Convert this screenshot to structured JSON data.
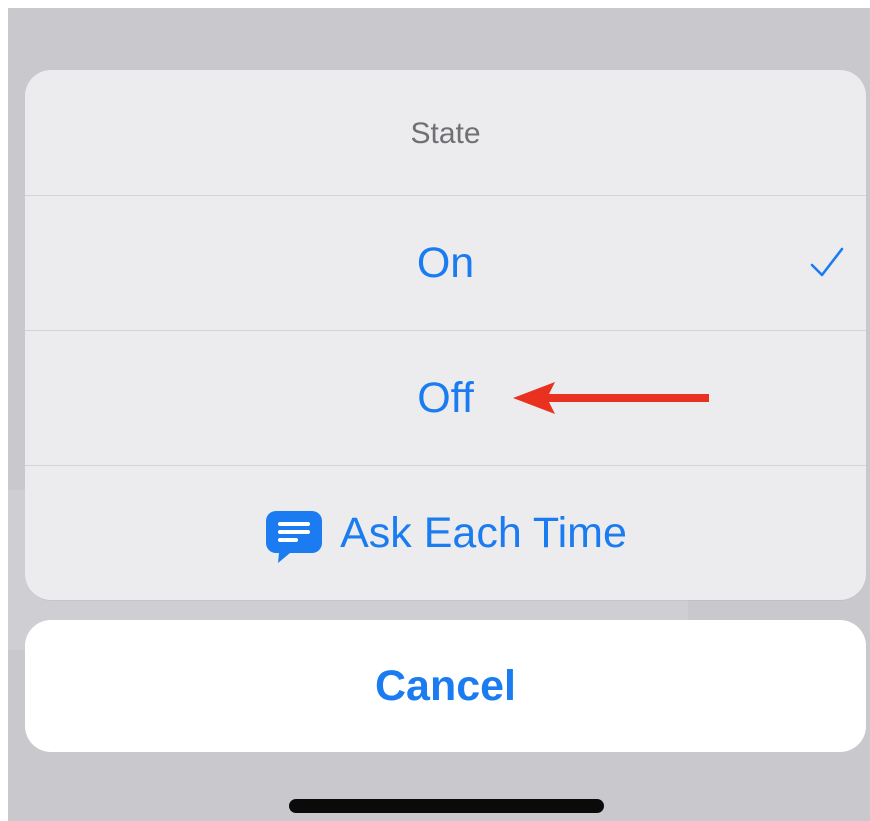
{
  "action_sheet": {
    "title": "State",
    "options": [
      {
        "label": "On",
        "selected": true,
        "icon": "checkmark-icon"
      },
      {
        "label": "Off",
        "selected": false,
        "annotation": "red-arrow-icon"
      },
      {
        "label": "Ask Each Time",
        "selected": false,
        "icon": "speech-bubble-icon"
      }
    ],
    "cancel_label": "Cancel"
  },
  "colors": {
    "accent": "#1a7cf0",
    "title_text": "#707074",
    "sheet_bg": "#ececee",
    "backdrop": "#c9c9cd",
    "annotation_arrow": "#e8321f"
  }
}
